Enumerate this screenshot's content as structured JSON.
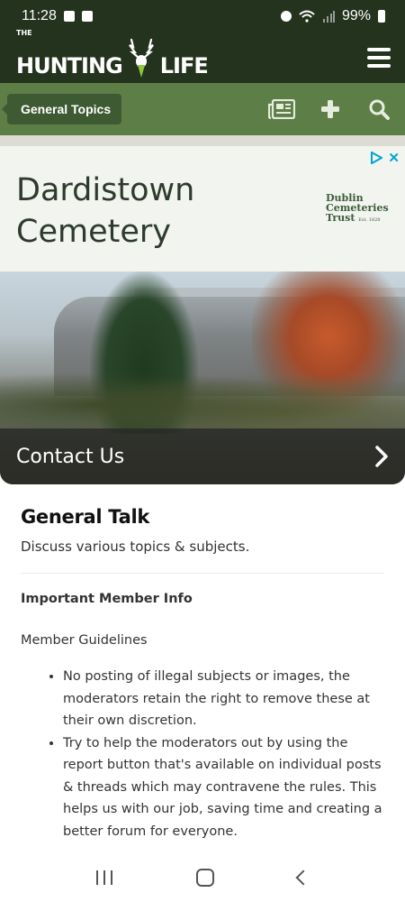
{
  "status_bar": {
    "time": "11:28",
    "battery": "99%"
  },
  "header": {
    "logo_the": "THE",
    "logo_left": "HUNTING",
    "logo_right": "LIFE"
  },
  "subnav": {
    "breadcrumb": "General Topics"
  },
  "ad": {
    "headline": "Dardistown Cemetery",
    "brand_line1": "Dublin",
    "brand_line2": "Cemeteries",
    "brand_line3": "Trust",
    "brand_small": "Est. 1828",
    "cta_label": "Contact Us"
  },
  "forum": {
    "title": "General Talk",
    "description": "Discuss various topics & subjects.",
    "info_heading": "Important Member Info",
    "guidelines_heading": "Member Guidelines",
    "rules": [
      "No posting of illegal subjects or images, the moderators retain the right to remove these at their own discretion.",
      "Try to help the moderators out by using the report button that's available on individual posts & threads which may contravene the rules. This helps us with our job, saving time and creating a better forum for everyone."
    ]
  },
  "colors": {
    "header_bg": "#23331d",
    "subnav_bg": "#5d7e46",
    "breadcrumb_bg": "#3e5a32",
    "accent_green": "#8dc63f"
  }
}
